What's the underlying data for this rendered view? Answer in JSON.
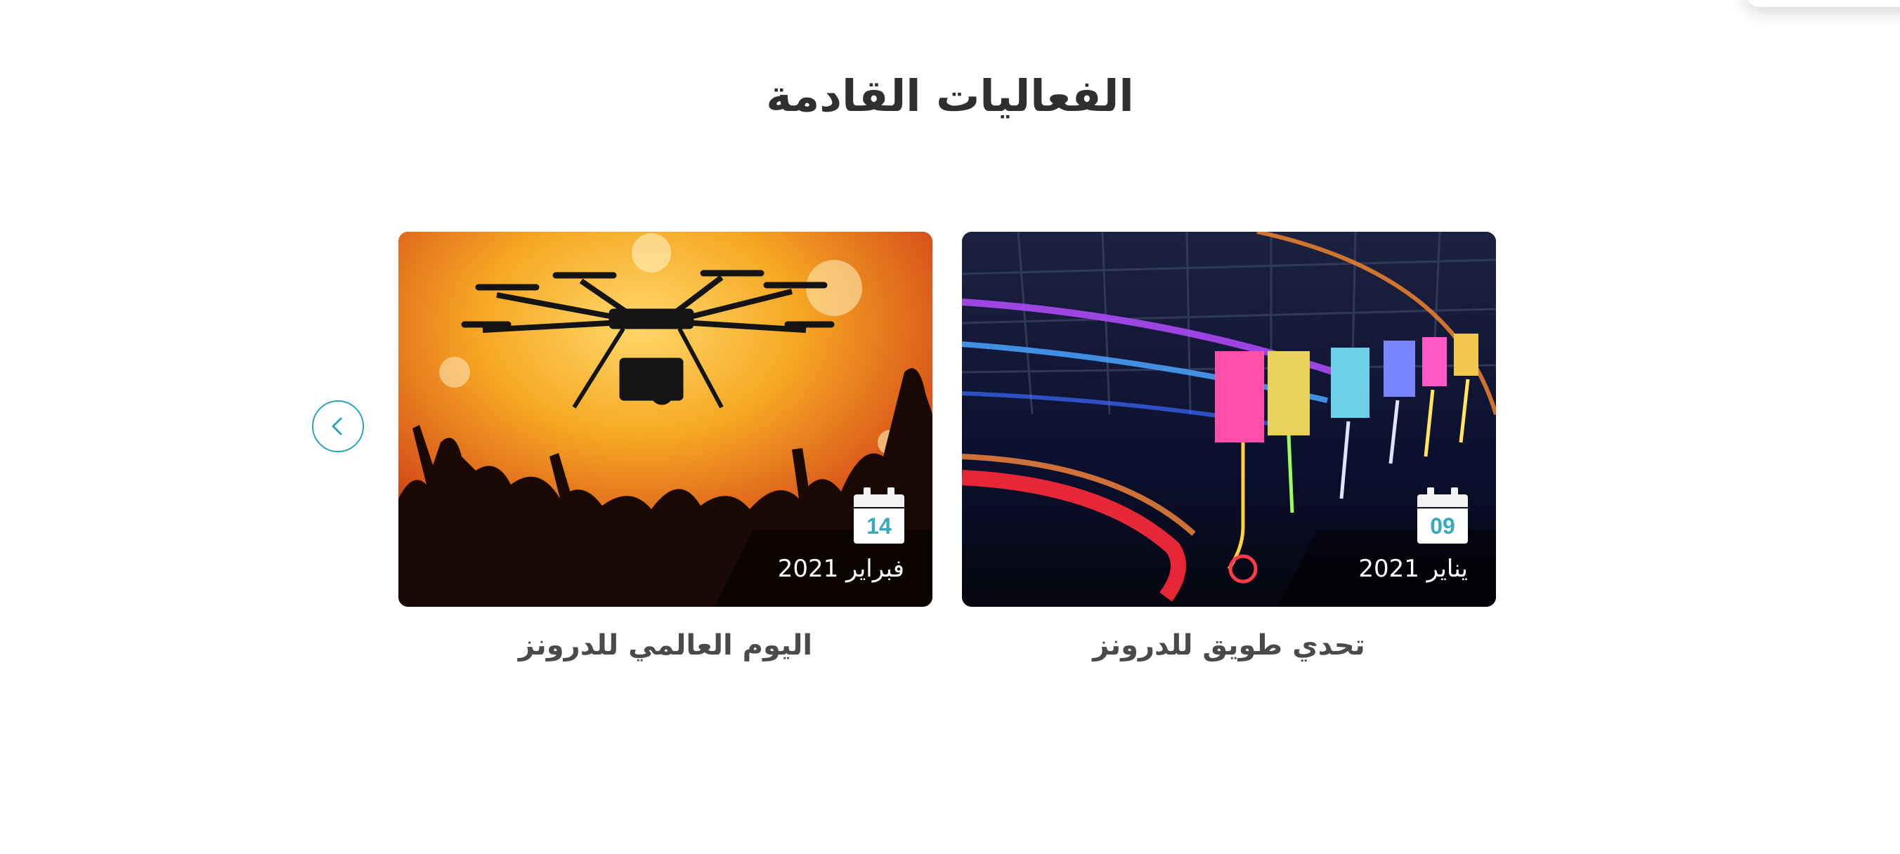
{
  "section": {
    "title": "الفعاليات القادمة"
  },
  "carousel": {
    "prev_icon": "chevron-left-icon",
    "accent_color": "#2aa5b8"
  },
  "events": [
    {
      "title": "اليوم العالمي للدرونز",
      "day": "14",
      "month_year": "فبراير 2021",
      "image": "drone-concert-image"
    },
    {
      "title": "تحدي طويق للدرونز",
      "day": "09",
      "month_year": "يناير 2021",
      "image": "drone-race-arena-image"
    }
  ]
}
